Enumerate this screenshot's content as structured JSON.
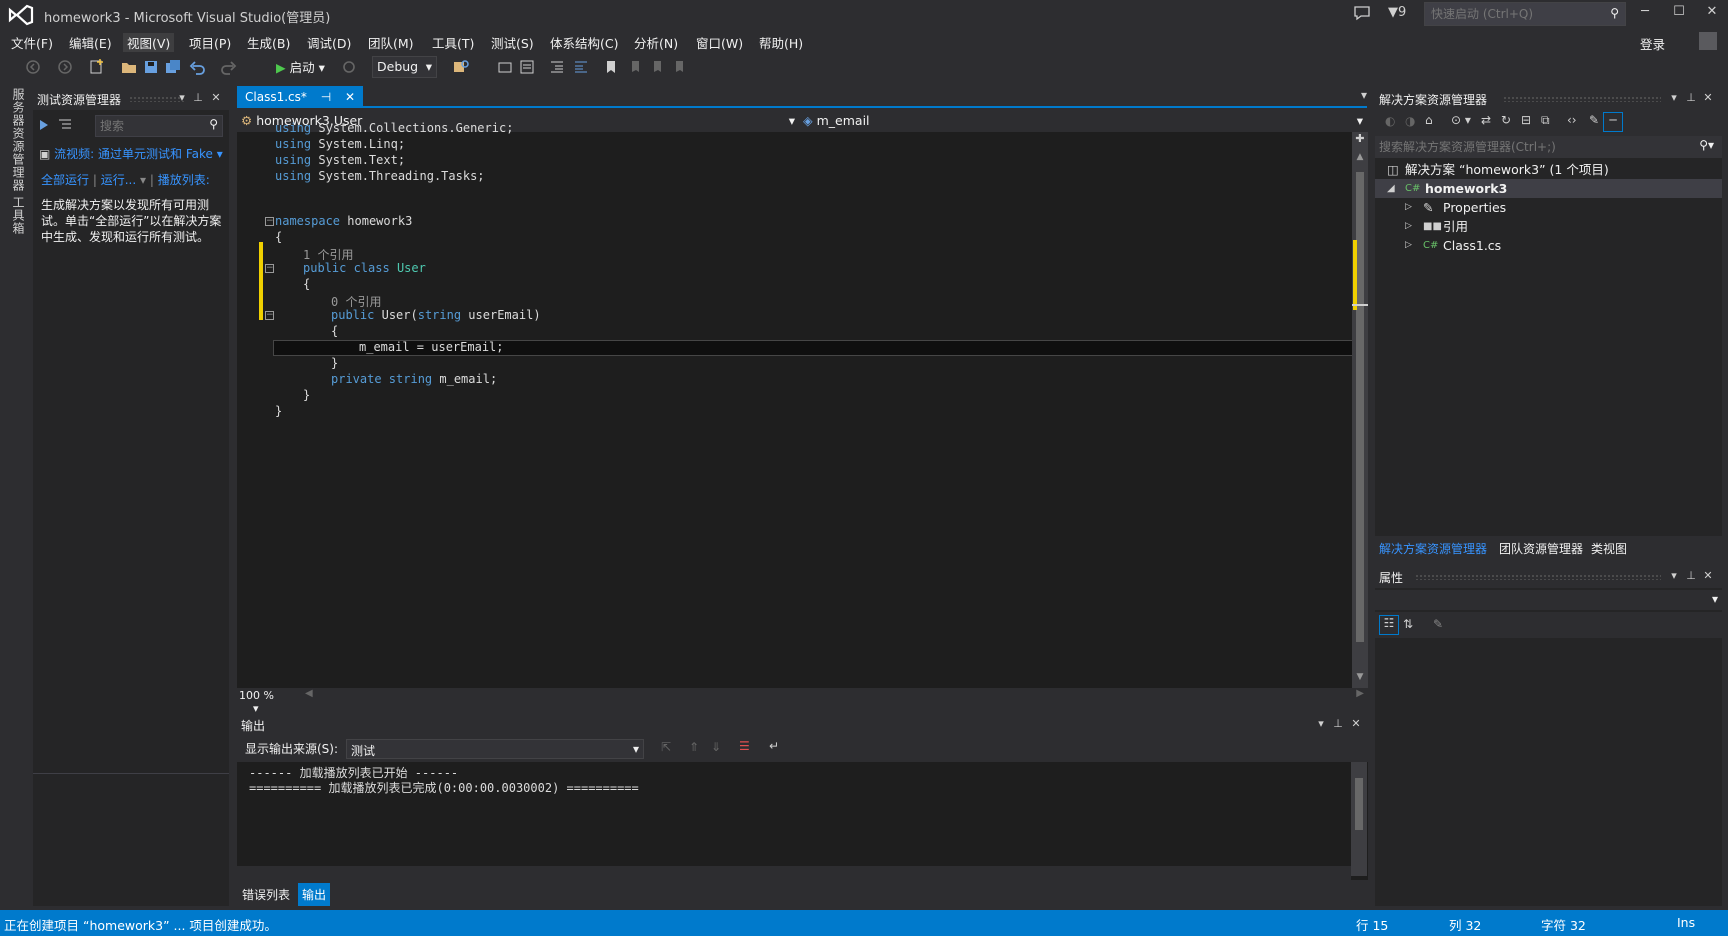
{
  "window": {
    "title": "homework3 - Microsoft Visual Studio(管理员)",
    "notification_count": "9",
    "quick_launch_placeholder": "快速启动 (Ctrl+Q)"
  },
  "menu": [
    "文件(F)",
    "编辑(E)",
    "视图(V)",
    "项目(P)",
    "生成(B)",
    "调试(D)",
    "团队(M)",
    "工具(T)",
    "测试(S)",
    "体系结构(C)",
    "分析(N)",
    "窗口(W)",
    "帮助(H)"
  ],
  "account": {
    "login": "登录"
  },
  "toolbar": {
    "start_label": "启动",
    "configuration": "Debug"
  },
  "left_vertical_tabs": [
    "服务器资源管理器",
    "工具箱"
  ],
  "test_explorer": {
    "title": "测试资源管理器",
    "search_placeholder": "搜索",
    "video_link": "流视频: 通过单元测试和 Fake",
    "run_all": "全部运行",
    "run": "运行...",
    "playlist": "播放列表:",
    "description": "生成解决方案以发现所有可用测试。单击“全部运行”以在解决方案中生成、发现和运行所有测试。"
  },
  "editor": {
    "tab_label": "Class1.cs*",
    "nav_class": "homework3.User",
    "nav_member": "m_email",
    "zoom": "100 %",
    "code": {
      "using1": "System.Collections.Generic;",
      "using2": "System.Linq;",
      "using3": "System.Text;",
      "using4": "System.Threading.Tasks;",
      "ns_name": "homework3",
      "ref1": "1 个引用",
      "class_name": "User",
      "ref0": "0 个引用",
      "ctor_name": "User(",
      "ctor_param": " userEmail)",
      "assign": "m_email = userEmail;",
      "field_name": " m_email;",
      "open_brace": "{",
      "close_brace": "}"
    }
  },
  "output": {
    "title": "输出",
    "source_label": "显示输出来源(S):",
    "source_value": "测试",
    "lines": [
      "------ 加载播放列表已开始 ------",
      "========== 加载播放列表已完成(0:00:00.0030002) =========="
    ]
  },
  "bottom_tabs": {
    "errors": "错误列表",
    "output": "输出"
  },
  "solution_explorer": {
    "title": "解决方案资源管理器",
    "search_placeholder": "搜索解决方案资源管理器(Ctrl+;)",
    "solution_row": "解决方案 “homework3” (1 个项目)",
    "project": "homework3",
    "items": [
      "Properties",
      "引用",
      "Class1.cs"
    ],
    "tabs": [
      "解决方案资源管理器",
      "团队资源管理器",
      "类视图"
    ]
  },
  "properties": {
    "title": "属性"
  },
  "statusbar": {
    "message": "正在创建项目 “homework3” ... 项目创建成功。",
    "line": "行 15",
    "col": "列 32",
    "char": "字符 32",
    "mode": "Ins"
  },
  "colors": {
    "accent": "#007acc",
    "keyword": "#569cd6",
    "type": "#4ec9b0",
    "background": "#2d2d30"
  }
}
